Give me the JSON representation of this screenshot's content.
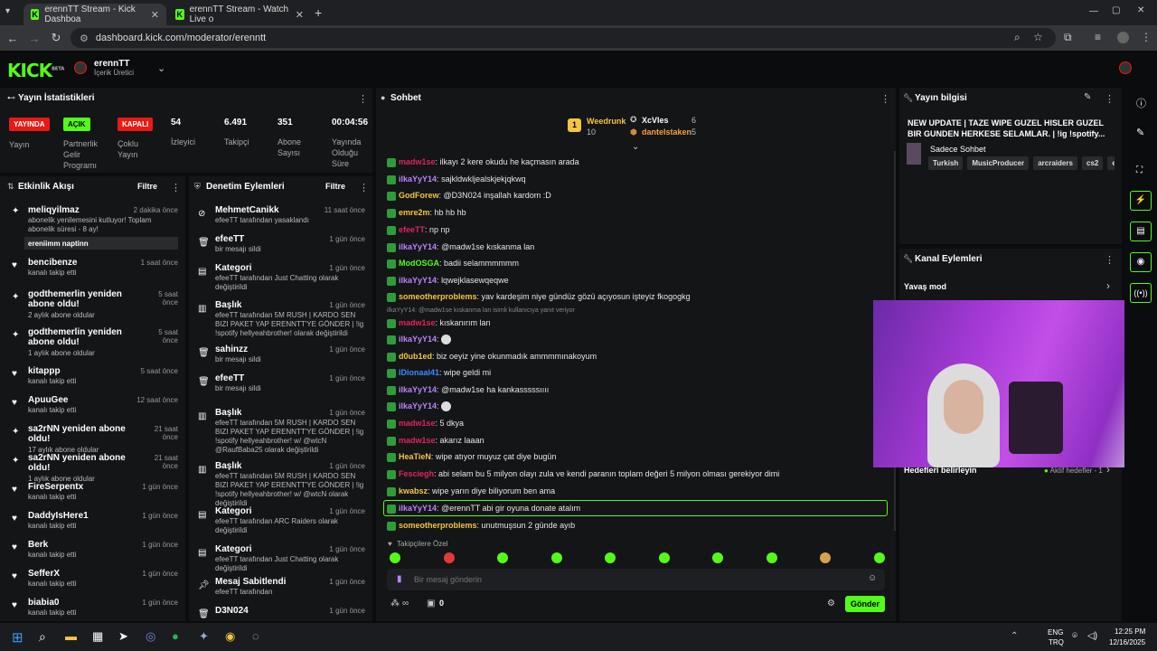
{
  "browser": {
    "tabs": [
      {
        "title": "erennTT Stream - Kick Dashboa"
      },
      {
        "title": "erennTT Stream - Watch Live o"
      }
    ],
    "url": "dashboard.kick.com/moderator/erenntt"
  },
  "header": {
    "channel_name": "erennTT",
    "channel_role": "İçerik Üretici",
    "logo": "KICK",
    "beta": "BETA"
  },
  "stats": {
    "title": "Yayın İstatistikleri",
    "items": [
      {
        "badge": "YAYINDA",
        "label": "Yayın",
        "badge_color": "#e91916"
      },
      {
        "badge": "AÇIK",
        "label": "Partnerlik Gelir Programı",
        "badge_color": "#53fc18"
      },
      {
        "badge": "KAPALI",
        "label": "Çoklu Yayın",
        "badge_color": "#e91916"
      },
      {
        "value": "54",
        "label": "İzleyici"
      },
      {
        "value": "6.491",
        "label": "Takipçi"
      },
      {
        "value": "351",
        "label": "Abone Sayısı"
      },
      {
        "value": "00:04:56",
        "label": "Yayında Olduğu Süre"
      }
    ]
  },
  "activity": {
    "title": "Etkinlik Akışı",
    "filter": "Filtre",
    "items": [
      {
        "name": "meliqyilmaz",
        "sub": "abonelik yenilemesini kutluyor! Toplam abonelik süresi - 8 ay!",
        "time": "2 dakika önce",
        "msg": "ereniimm naptinn",
        "icon": "star-icon"
      },
      {
        "name": "bencibenze",
        "sub": "kanalı takip etti",
        "time": "1 saat önce",
        "icon": "heart-icon"
      },
      {
        "name": "godthemerlin yeniden abone oldu!",
        "sub": "2 aylık abone oldular",
        "time": "5 saat önce",
        "icon": "star-icon"
      },
      {
        "name": "godthemerlin yeniden abone oldu!",
        "sub": "1 aylık abone oldular",
        "time": "5 saat önce",
        "icon": "star-icon"
      },
      {
        "name": "kitappp",
        "sub": "kanalı takip etti",
        "time": "5 saat önce",
        "icon": "heart-icon"
      },
      {
        "name": "ApuuGee",
        "sub": "kanalı takip etti",
        "time": "12 saat önce",
        "icon": "heart-icon"
      },
      {
        "name": "sa2rNN yeniden abone oldu!",
        "sub": "17 aylık abone oldular",
        "time": "21 saat önce",
        "icon": "star-icon"
      },
      {
        "name": "sa2rNN yeniden abone oldu!",
        "sub": "1 aylık abone oldular",
        "time": "21 saat önce",
        "icon": "star-icon"
      },
      {
        "name": "FireSerpentx",
        "sub": "kanalı takip etti",
        "time": "1 gün önce",
        "icon": "heart-icon"
      },
      {
        "name": "DaddyIsHere1",
        "sub": "kanalı takip etti",
        "time": "1 gün önce",
        "icon": "heart-icon"
      },
      {
        "name": "Berk",
        "sub": "kanalı takip etti",
        "time": "1 gün önce",
        "icon": "heart-icon"
      },
      {
        "name": "SefferX",
        "sub": "kanalı takip etti",
        "time": "1 gün önce",
        "icon": "heart-icon"
      },
      {
        "name": "biabia0",
        "sub": "kanalı takip etti",
        "time": "1 gün önce",
        "icon": "heart-icon"
      }
    ]
  },
  "modlog": {
    "title": "Denetim Eylemleri",
    "filter": "Filtre",
    "items": [
      {
        "name": "MehmetCanikk",
        "sub": "efeeTT tarafından yasaklandı",
        "time": "11 saat önce",
        "icon": "ban-icon"
      },
      {
        "name": "efeeTT",
        "sub": "bir mesajı sildi",
        "time": "1 gün önce",
        "icon": "trash-icon"
      },
      {
        "name": "Kategori",
        "sub": "efeeTT tarafından Just Chatting olarak değiştirildi",
        "time": "1 gün önce",
        "icon": "category-icon"
      },
      {
        "name": "Başlık",
        "sub": "efeeTT tarafından 5M RUSH | KARDO SEN BIZI PAKET YAP ERENNTT'YE GÖNDER | !ig !spotify hellyeahbrother! olarak değiştirildi",
        "time": "1 gün önce",
        "icon": "title-icon"
      },
      {
        "name": "sahinzz",
        "sub": "bir mesajı sildi",
        "time": "1 gün önce",
        "icon": "trash-icon"
      },
      {
        "name": "efeeTT",
        "sub": "bir mesajı sildi",
        "time": "1 gün önce",
        "icon": "trash-icon"
      },
      {
        "name": "Başlık",
        "sub": "efeeTT tarafından 5M RUSH | KARDO SEN BIZI PAKET YAP ERENNTT'YE GÖNDER | !ig !spotify hellyeahbrother! w/ @wtcN @RaufBaba25 olarak değiştirildi",
        "time": "1 gün önce",
        "icon": "title-icon"
      },
      {
        "name": "Başlık",
        "sub": "efeeTT tarafından 5M RUSH | KARDO SEN BIZI PAKET YAP ERENNTT'YE GÖNDER | !ig !spotify hellyeahbrother! w/ @wtcN olarak değiştirildi",
        "time": "1 gün önce",
        "icon": "title-icon"
      },
      {
        "name": "Kategori",
        "sub": "efeeTT tarafından ARC Raiders olarak değiştirildi",
        "time": "1 gün önce",
        "icon": "category-icon"
      },
      {
        "name": "Kategori",
        "sub": "efeeTT tarafından Just Chatting olarak değiştirildi",
        "time": "1 gün önce",
        "icon": "category-icon"
      },
      {
        "name": "Mesaj Sabitlendi",
        "sub": "efeeTT tarafından",
        "time": "1 gün önce",
        "icon": "pin-icon"
      },
      {
        "name": "D3N024",
        "sub": "",
        "time": "1 gün önce",
        "icon": "trash-icon"
      }
    ]
  },
  "chat": {
    "title": "Sohbet",
    "leaderboard": [
      {
        "rank": "1",
        "name": "Weedrunk",
        "count": "10"
      },
      {
        "name": "XcVles",
        "count": "6"
      },
      {
        "name": "dantelstaken",
        "count": "5"
      }
    ],
    "messages": [
      {
        "user": "madw1se",
        "color": "#e0245e",
        "text": "ilkayı 2 kere okudu he kaçmasın arada"
      },
      {
        "user": "ilkaYyY14",
        "color": "#b983ff",
        "text": "sajkldwkljealskjekjqkwq"
      },
      {
        "user": "GodForew",
        "color": "#f5c542",
        "text": "@D3N024 inşallah kardom :D"
      },
      {
        "user": "emre2m",
        "color": "#f5c542",
        "text": "hb hb hb"
      },
      {
        "user": "efeeTT",
        "color": "#e0245e",
        "text": "np np"
      },
      {
        "user": "ilkaYyY14",
        "color": "#b983ff",
        "text": "@madw1se kıskanma lan"
      },
      {
        "user": "ModOSGA",
        "color": "#53fc18",
        "text": "badii selammmmmm"
      },
      {
        "user": "ilkaYyY14",
        "color": "#b983ff",
        "text": "lqwejklasewqeqwe"
      },
      {
        "user": "someotherproblems",
        "color": "#f5c542",
        "text": "yav kardeşim niye gündüz gözü açıyosun işteyiz fkogogkg"
      },
      {
        "user": "madw1se",
        "color": "#e0245e",
        "text": "kıskanırım lan",
        "reply": "ilkaYyY14: @madw1se kıskanma lan isimli kullanıcıya yanıt veriyor"
      },
      {
        "user": "ilkaYyY14",
        "color": "#b983ff",
        "text": ""
      },
      {
        "user": "d0ub1ed",
        "color": "#f5c542",
        "text": "biz oeyiz yine okunmadık ammmmınakoyum"
      },
      {
        "user": "IDionaal41",
        "color": "#3d8bff",
        "text": "wipe geldi mi"
      },
      {
        "user": "ilkaYyY14",
        "color": "#b983ff",
        "text": "@madw1se ha kankasssssıııı"
      },
      {
        "user": "ilkaYyY14",
        "color": "#b983ff",
        "text": ""
      },
      {
        "user": "madw1se",
        "color": "#e0245e",
        "text": "5 dkya"
      },
      {
        "user": "madw1se",
        "color": "#e0245e",
        "text": "akarız laaan"
      },
      {
        "user": "HeaTieN",
        "color": "#f5c542",
        "text": "wipe atıyor muyuz çat diye bugün"
      },
      {
        "user": "Fesciegh",
        "color": "#e0245e",
        "text": "abi selam bu 5 milyon olayı zula ve kendi paranın toplam değeri 5 milyon olması gerekiyor dimi"
      },
      {
        "user": "kwabsz",
        "color": "#f5c542",
        "text": "wipe yarın diye biliyorum ben ama"
      },
      {
        "user": "ilkaYyY14",
        "color": "#b983ff",
        "text": "@erennTT abi gir oyuna donate atalım"
      },
      {
        "user": "someotherproblems",
        "color": "#f5c542",
        "text": "unutmuşsun 2 günde ayıb"
      }
    ],
    "followers_only": "Takipçilere Özel",
    "placeholder": "Bir mesaj gönderin",
    "points": "∞",
    "count": "0",
    "send": "Gönder"
  },
  "stream_info": {
    "title": "Yayın bilgisi",
    "stream_title": "NEW UPDATE | TAZE WIPE GUZEL HISLER GUZEL BIR GUNDEN HERKESE SELAMLAR. | !ig !spotify...",
    "category": "Sadece Sohbet",
    "tags": [
      "Turkish",
      "MusicProducer",
      "arcraiders",
      "cs2",
      "erer"
    ]
  },
  "channel_actions": {
    "title": "Kanal Eylemleri",
    "slow_mode": "Yavaş mod",
    "goals": "Hedefleri belirleyin",
    "goals_status": "Aktif hedefler - 1"
  },
  "taskbar": {
    "lang": "ENG",
    "lang2": "TRQ",
    "time": "12:25 PM",
    "date": "12/16/2025"
  },
  "colors": {
    "accent": "#53fc18",
    "live": "#e91916",
    "bg": "#0b0c0d",
    "panel": "#141517"
  }
}
